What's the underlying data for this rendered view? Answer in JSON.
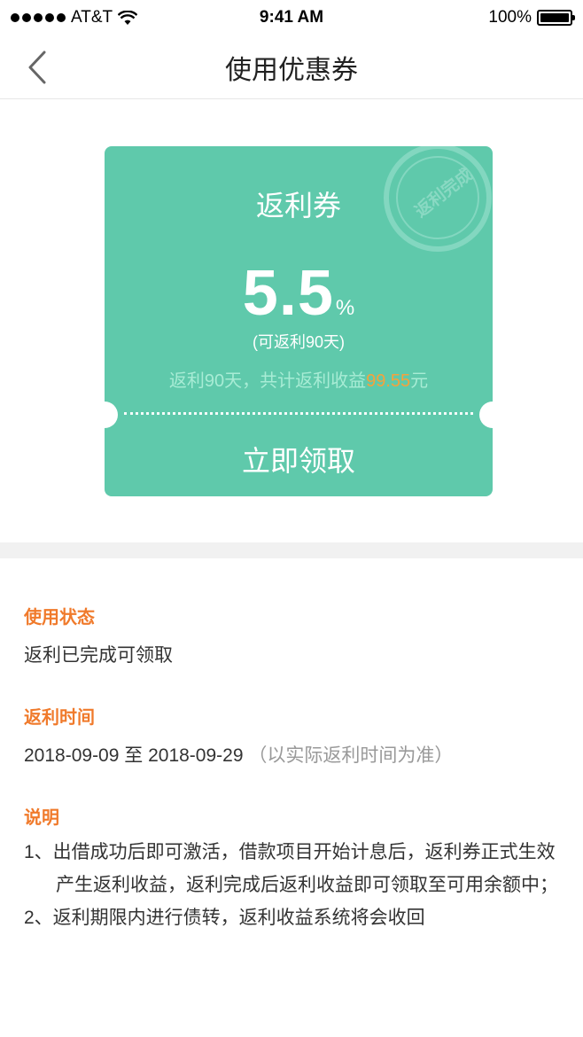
{
  "status_bar": {
    "carrier": "AT&T",
    "time": "9:41 AM",
    "battery": "100%"
  },
  "nav": {
    "title": "使用优惠券",
    "back_icon": "chevron-left-icon"
  },
  "coupon": {
    "title": "返利券",
    "rate_value": "5.5",
    "rate_unit": "%",
    "period": "(可返利90天)",
    "earnings_prefix": "返利90天，共计返利收益",
    "earnings_amount": "99.55",
    "earnings_suffix": "元",
    "claim_label": "立即领取",
    "stamp_text": "返利完成",
    "colors": {
      "card": "#5fc9ab",
      "earnings_text": "#a8ecd5",
      "amount": "#f6a23b"
    }
  },
  "details": {
    "status_label": "使用状态",
    "status_value": "返利已完成可领取",
    "time_label": "返利时间",
    "time_value": "2018-09-09 至 2018-09-29",
    "time_note": "（以实际返利时间为准）",
    "desc_label": "说明",
    "desc_lines": [
      "1、出借成功后即可激活，借款项目开始计息后，返利券正式生效",
      "产生返利收益，返利完成后返利收益即可领取至可用余额中；",
      "2、返利期限内进行债转，返利收益系统将会收回"
    ],
    "label_color": "#f07a2b"
  }
}
